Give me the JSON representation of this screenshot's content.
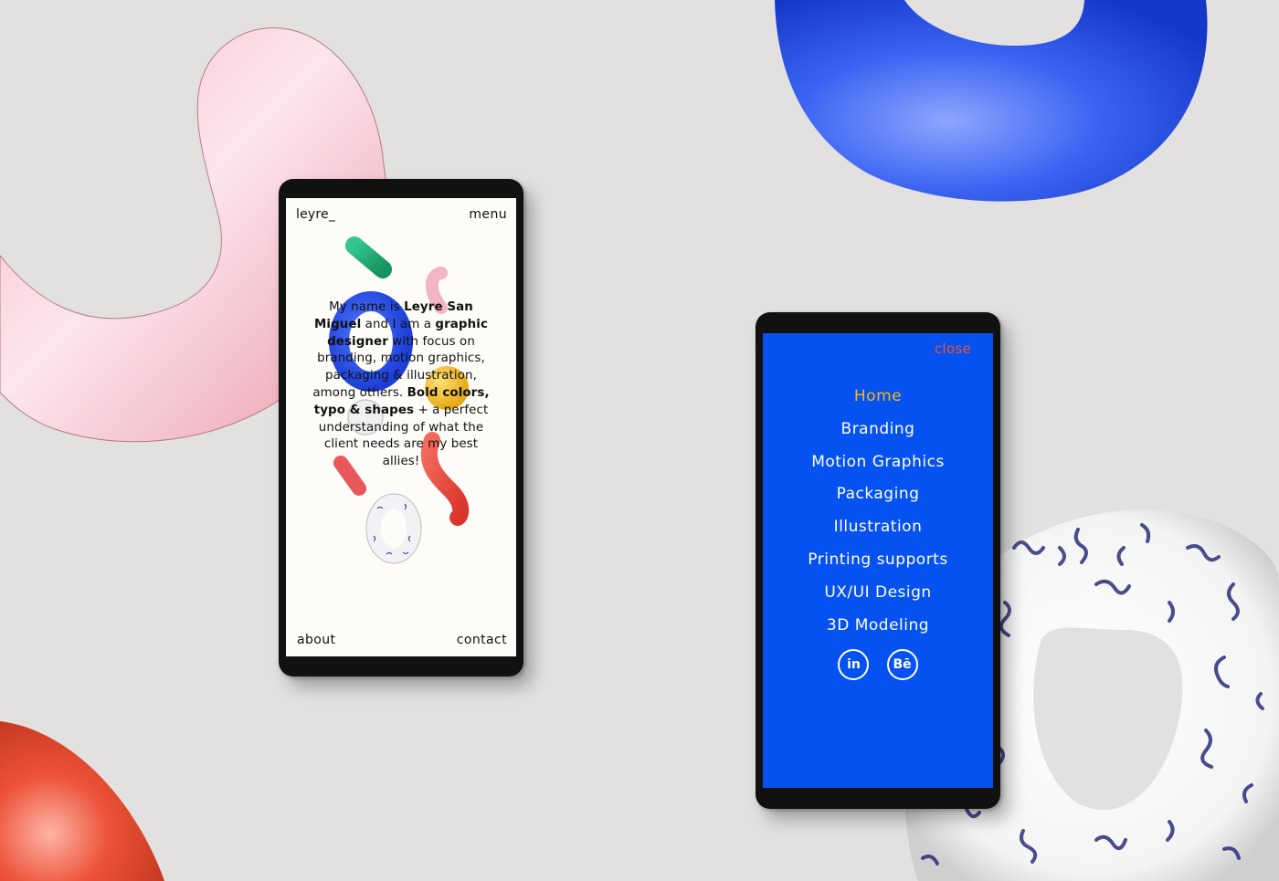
{
  "background": {
    "color": "#e2e1df",
    "shapes": [
      {
        "name": "pink-blob-shape",
        "color": "#f4a9b6"
      },
      {
        "name": "blue-torus-shape",
        "color": "#1d4ef0"
      },
      {
        "name": "red-blob-shape",
        "color": "#e8452e"
      },
      {
        "name": "patterned-torus-shape",
        "color": "#ffffff",
        "pattern_color": "#2a2f78"
      }
    ]
  },
  "phone_home": {
    "logo": "leyre_",
    "menu_label": "menu",
    "bio": {
      "parts": [
        {
          "text": "My name is ",
          "bold": false
        },
        {
          "text": "Leyre San Miguel",
          "bold": true
        },
        {
          "text": " and I am a ",
          "bold": false
        },
        {
          "text": "graphic designer",
          "bold": true
        },
        {
          "text": " with focus on branding, motion graphics, packaging & illustration, among others. ",
          "bold": false
        },
        {
          "text": "Bold colors, typo & shapes",
          "bold": true
        },
        {
          "text": " + a perfect understanding of what the client needs are my best allies!",
          "bold": false
        }
      ]
    },
    "footer": {
      "about_label": "about",
      "contact_label": "contact"
    },
    "colors": {
      "screen": "#fdfcf9",
      "text": "#111111"
    }
  },
  "phone_menu": {
    "close_label": "close",
    "nav_items": [
      {
        "label": "Home",
        "active": true
      },
      {
        "label": "Branding",
        "active": false
      },
      {
        "label": "Motion Graphics",
        "active": false
      },
      {
        "label": "Packaging",
        "active": false
      },
      {
        "label": "Illustration",
        "active": false
      },
      {
        "label": "Printing supports",
        "active": false
      },
      {
        "label": "UX/UI Design",
        "active": false
      },
      {
        "label": "3D Modeling",
        "active": false
      }
    ],
    "social": [
      {
        "name": "linkedin",
        "glyph": "in"
      },
      {
        "name": "behance",
        "glyph": "Bē"
      }
    ],
    "colors": {
      "screen": "#0552f0",
      "active": "#f5b51c",
      "close": "#f2502c",
      "text": "#ffffff"
    }
  }
}
